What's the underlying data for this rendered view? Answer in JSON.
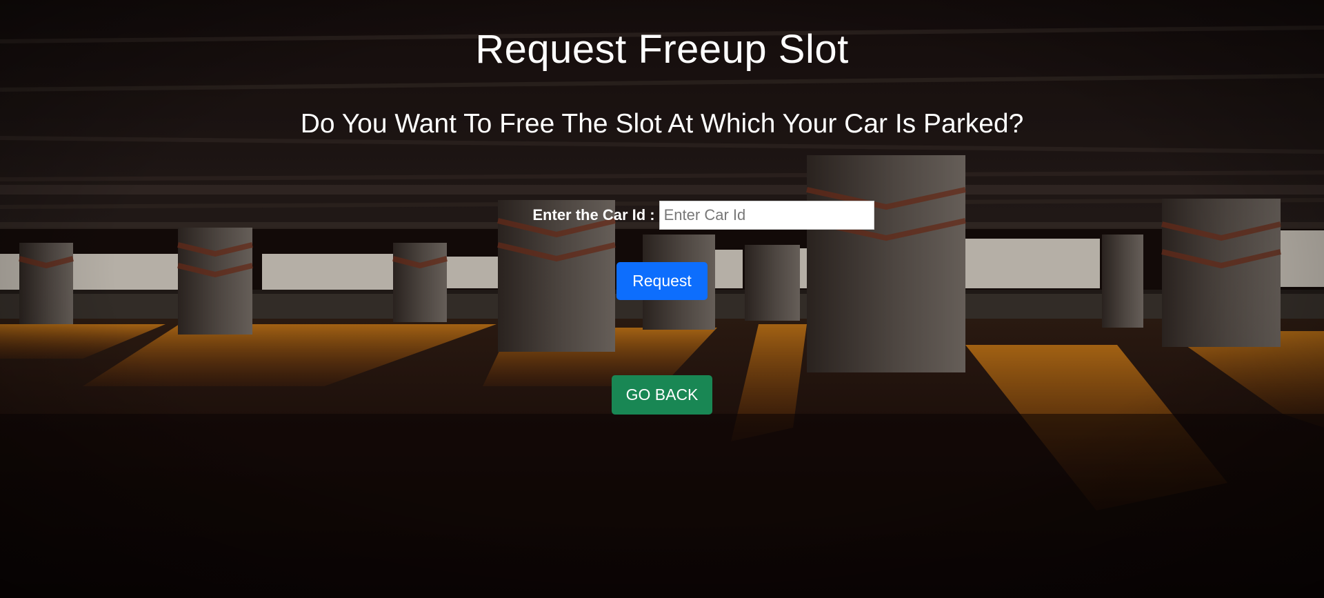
{
  "page": {
    "title": "Request Freeup Slot",
    "subtitle": "Do You Want To Free The Slot At Which Your Car Is Parked?"
  },
  "form": {
    "car_id_label": "Enter the Car Id :",
    "car_id_placeholder": "Enter Car Id",
    "car_id_value": "",
    "request_button_label": "Request"
  },
  "navigation": {
    "go_back_label": "GO BACK"
  },
  "colors": {
    "primary_button": "#0d6efd",
    "success_button": "#198754",
    "text": "#ffffff"
  }
}
